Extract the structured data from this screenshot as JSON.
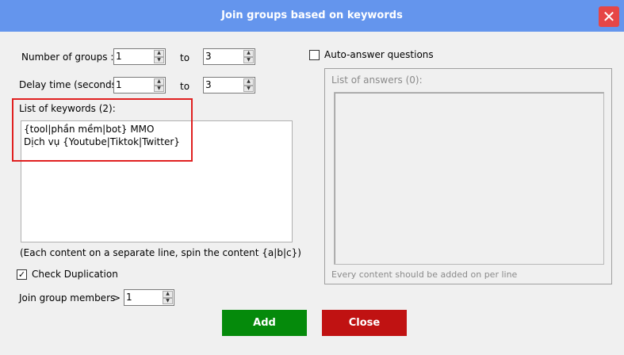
{
  "window": {
    "title": "Join groups based on keywords",
    "close_glyph": "✕"
  },
  "groups": {
    "label": "Number of groups :",
    "from": "1",
    "to_label": "to",
    "to": "3"
  },
  "delay": {
    "label": "Delay time (seconds):",
    "from": "1",
    "to_label": "to",
    "to": "3"
  },
  "keywords": {
    "label": "List of keywords (2):",
    "lines": [
      "{tool|phần mềm|bot} MMO",
      "Dịch vụ {Youtube|Tiktok|Twitter}"
    ],
    "hint": "(Each content on a separate line, spin the content {a|b|c})"
  },
  "duplication": {
    "label": "Check Duplication",
    "checked_glyph": "✓"
  },
  "members": {
    "label": "Join group members",
    "operator": ">",
    "value": "1"
  },
  "auto_answer": {
    "label": "Auto-answer questions",
    "list_label": "List of answers (0):",
    "hint": "Every content should be added on per line"
  },
  "buttons": {
    "add": "Add",
    "close": "Close"
  },
  "colors": {
    "title_bar": "#6495ed",
    "add": "#058a0b",
    "close": "#c01212",
    "highlight": "#e02020"
  }
}
